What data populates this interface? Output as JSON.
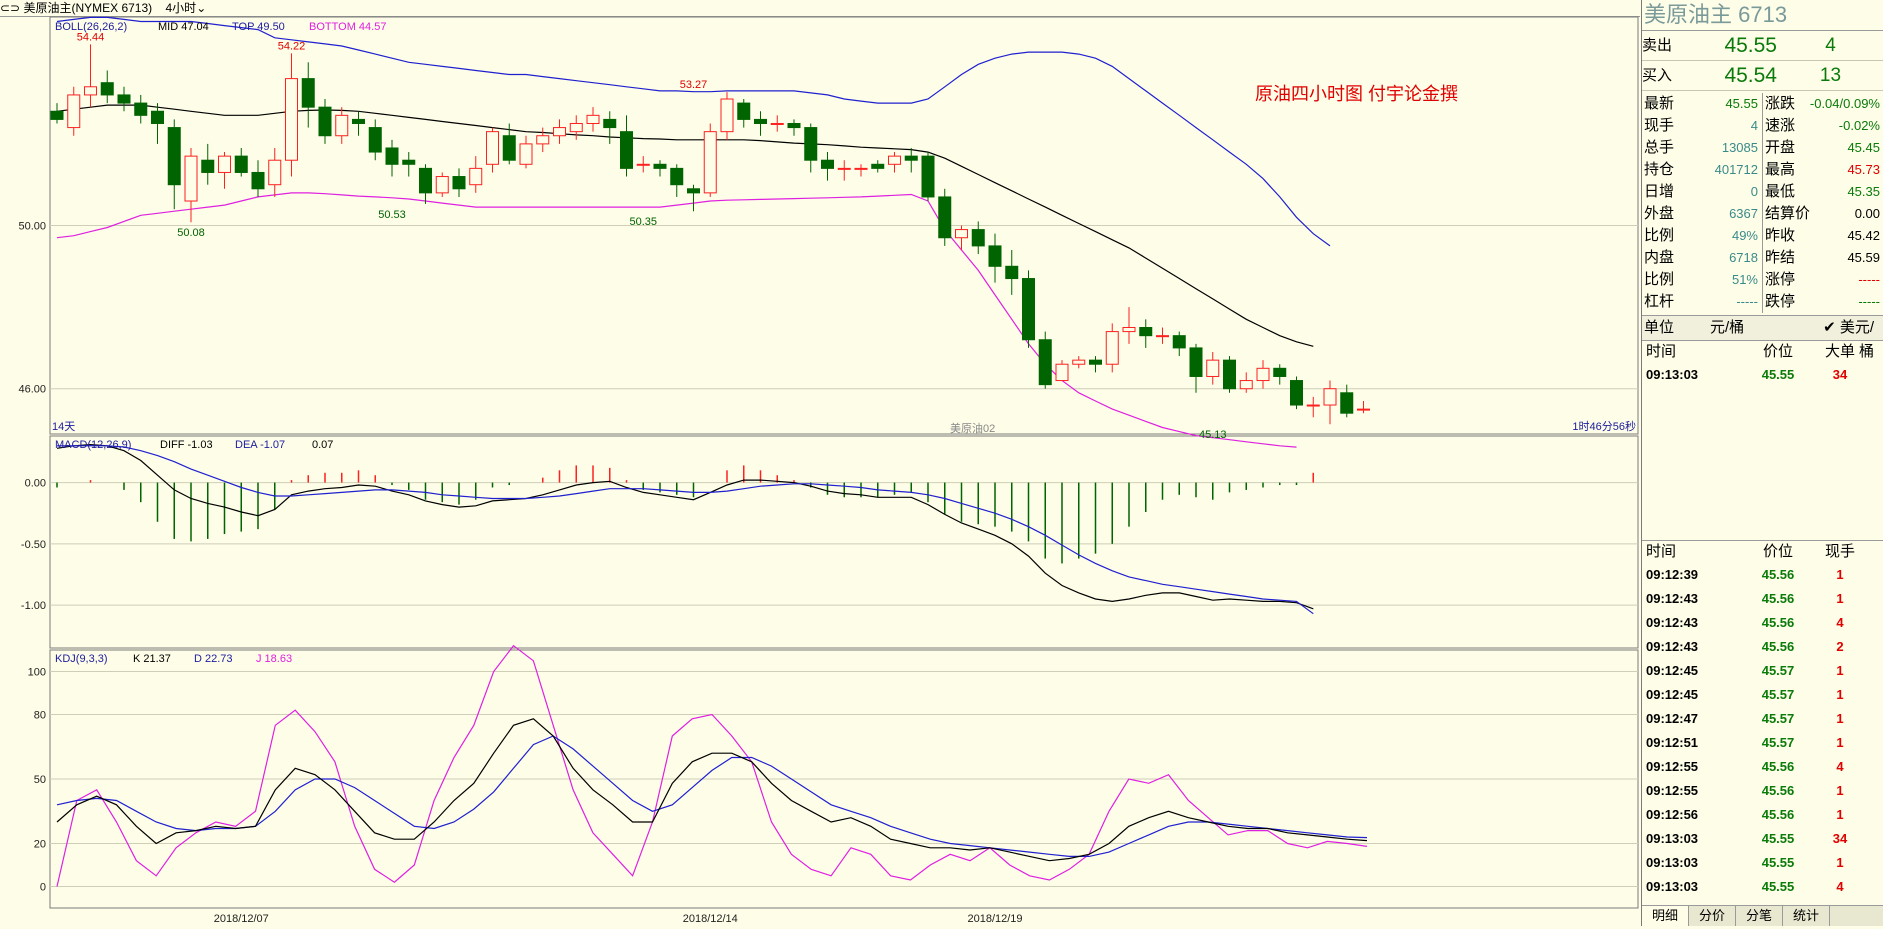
{
  "header": {
    "symbol": "美原油主(NYMEX 6713)",
    "period": "4小时"
  },
  "colors": {
    "up": "#ff2020",
    "down": "#006400",
    "boll_band": "#2020d0",
    "boll_bottom": "#e020e0",
    "mid": "#000000",
    "k": "#000000",
    "d": "#2020d0",
    "j": "#e020e0",
    "bg": "#fdfde8",
    "grid": "#cfcfb8"
  },
  "chart_data": {
    "type": "candlestick",
    "x_tick_labels": [
      "2018/12/07",
      "2018/12/14",
      "2018/12/19"
    ],
    "x_tick_index": [
      11,
      39,
      56
    ],
    "price_axis": {
      "ticks": [
        50.0,
        46.0
      ],
      "tick_labels": [
        "50.00",
        "46.00"
      ],
      "ylim": [
        44.89,
        55.11
      ]
    },
    "boll": {
      "label": "BOLL(26,26,2)",
      "mid_label": "MID 47.04",
      "top_label": "TOP 49.50",
      "bottom_label": "BOTTOM 44.57"
    },
    "annotation": "原油四小时图  付宇论金撰",
    "peak_labels": [
      {
        "text": "54.44",
        "index": 2,
        "value": 54.44,
        "kind": "high"
      },
      {
        "text": "54.22",
        "index": 14,
        "value": 54.22,
        "kind": "high"
      },
      {
        "text": "53.27",
        "index": 38,
        "value": 53.27,
        "kind": "high"
      },
      {
        "text": "50.08",
        "index": 8,
        "value": 50.08,
        "kind": "low"
      },
      {
        "text": "50.53",
        "index": 20,
        "value": 50.53,
        "kind": "low"
      },
      {
        "text": "50.35",
        "index": 35,
        "value": 50.35,
        "kind": "low"
      },
      {
        "text": "45.13",
        "index": 69,
        "value": 45.13,
        "kind": "low"
      }
    ],
    "candles": [
      [
        52.8,
        52.6,
        53.0,
        52.5
      ],
      [
        52.4,
        53.2,
        53.4,
        52.2
      ],
      [
        53.2,
        53.4,
        54.44,
        52.9
      ],
      [
        53.5,
        53.2,
        53.8,
        53.0
      ],
      [
        53.2,
        53.0,
        53.4,
        52.8
      ],
      [
        53.0,
        52.7,
        53.2,
        52.5
      ],
      [
        52.8,
        52.5,
        53.0,
        52.0
      ],
      [
        52.4,
        51.0,
        52.6,
        50.4
      ],
      [
        50.6,
        51.7,
        51.9,
        50.08
      ],
      [
        51.6,
        51.3,
        52.0,
        51.0
      ],
      [
        51.3,
        51.7,
        51.8,
        50.9
      ],
      [
        51.7,
        51.3,
        51.9,
        51.2
      ],
      [
        51.3,
        50.9,
        51.6,
        50.7
      ],
      [
        51.0,
        51.6,
        51.9,
        50.7
      ],
      [
        51.6,
        53.6,
        54.22,
        51.2
      ],
      [
        53.6,
        52.9,
        54.0,
        52.4
      ],
      [
        52.9,
        52.2,
        53.1,
        52.0
      ],
      [
        52.2,
        52.7,
        52.9,
        52.0
      ],
      [
        52.6,
        52.5,
        52.8,
        52.2
      ],
      [
        52.4,
        51.8,
        52.6,
        51.6
      ],
      [
        51.9,
        51.5,
        52.1,
        51.2
      ],
      [
        51.6,
        51.5,
        51.8,
        51.2
      ],
      [
        51.4,
        50.8,
        51.5,
        50.53
      ],
      [
        50.8,
        51.2,
        51.3,
        50.7
      ],
      [
        51.2,
        50.9,
        51.4,
        50.7
      ],
      [
        51.0,
        51.4,
        51.7,
        50.8
      ],
      [
        51.5,
        52.3,
        52.4,
        51.3
      ],
      [
        52.2,
        51.6,
        52.5,
        51.5
      ],
      [
        51.5,
        52.0,
        52.2,
        51.4
      ],
      [
        52.0,
        52.2,
        52.4,
        51.8
      ],
      [
        52.2,
        52.4,
        52.6,
        52.0
      ],
      [
        52.3,
        52.5,
        52.7,
        52.1
      ],
      [
        52.5,
        52.7,
        52.9,
        52.3
      ],
      [
        52.6,
        52.4,
        52.8,
        52.0
      ],
      [
        52.3,
        51.4,
        52.7,
        51.2
      ],
      [
        51.5,
        51.5,
        51.7,
        51.3
      ],
      [
        51.5,
        51.4,
        51.6,
        51.2
      ],
      [
        51.4,
        51.0,
        51.5,
        50.7
      ],
      [
        50.9,
        50.8,
        51.0,
        50.35
      ],
      [
        50.8,
        52.3,
        52.5,
        50.7
      ],
      [
        52.3,
        53.1,
        53.27,
        52.1
      ],
      [
        53.0,
        52.6,
        53.1,
        52.4
      ],
      [
        52.6,
        52.5,
        52.8,
        52.2
      ],
      [
        52.5,
        52.5,
        52.7,
        52.3
      ],
      [
        52.5,
        52.4,
        52.6,
        52.2
      ],
      [
        52.4,
        51.6,
        52.5,
        51.3
      ],
      [
        51.6,
        51.4,
        51.8,
        51.1
      ],
      [
        51.4,
        51.4,
        51.6,
        51.1
      ],
      [
        51.4,
        51.4,
        51.5,
        51.2
      ],
      [
        51.5,
        51.4,
        51.6,
        51.3
      ],
      [
        51.5,
        51.7,
        51.8,
        51.3
      ],
      [
        51.7,
        51.6,
        51.9,
        51.3
      ],
      [
        51.7,
        50.7,
        51.8,
        50.6
      ],
      [
        50.7,
        49.7,
        50.9,
        49.5
      ],
      [
        49.7,
        49.9,
        50.0,
        49.4
      ],
      [
        49.9,
        49.5,
        50.1,
        49.3
      ],
      [
        49.5,
        49.0,
        49.8,
        48.6
      ],
      [
        49.0,
        48.7,
        49.4,
        48.3
      ],
      [
        48.7,
        47.2,
        48.9,
        47.0
      ],
      [
        47.2,
        46.1,
        47.4,
        46.0
      ],
      [
        46.2,
        46.6,
        46.7,
        46.3
      ],
      [
        46.6,
        46.7,
        46.8,
        46.5
      ],
      [
        46.7,
        46.6,
        46.8,
        46.4
      ],
      [
        46.6,
        47.4,
        47.6,
        46.4
      ],
      [
        47.4,
        47.5,
        48.0,
        47.1
      ],
      [
        47.5,
        47.3,
        47.7,
        47.0
      ],
      [
        47.3,
        47.3,
        47.5,
        47.1
      ],
      [
        47.3,
        47.0,
        47.4,
        46.8
      ],
      [
        47.0,
        46.3,
        47.1,
        45.9
      ],
      [
        46.3,
        46.7,
        46.9,
        46.1
      ],
      [
        46.7,
        46.0,
        46.8,
        45.9
      ],
      [
        46.0,
        46.2,
        46.4,
        45.9
      ],
      [
        46.2,
        46.5,
        46.7,
        46.0
      ],
      [
        46.5,
        46.3,
        46.6,
        46.1
      ],
      [
        46.2,
        45.6,
        46.3,
        45.5
      ],
      [
        45.6,
        45.6,
        45.8,
        45.3
      ],
      [
        45.6,
        46.0,
        46.2,
        45.13
      ],
      [
        45.9,
        45.4,
        46.1,
        45.3
      ],
      [
        45.5,
        45.5,
        45.7,
        45.4
      ]
    ],
    "boll_top": [
      55.0,
      55.05,
      55.1,
      55.1,
      55.05,
      55.0,
      55.0,
      55.0,
      55.0,
      54.95,
      54.9,
      54.85,
      54.8,
      54.6,
      54.55,
      54.5,
      54.45,
      54.4,
      54.3,
      54.2,
      54.1,
      54.0,
      53.95,
      53.9,
      53.85,
      53.8,
      53.75,
      53.7,
      53.7,
      53.65,
      53.6,
      53.55,
      53.5,
      53.45,
      53.4,
      53.35,
      53.3,
      53.3,
      53.28,
      53.28,
      53.3,
      53.3,
      53.3,
      53.3,
      53.3,
      53.25,
      53.2,
      53.1,
      53.05,
      53.0,
      53.0,
      53.0,
      53.1,
      53.4,
      53.7,
      53.95,
      54.1,
      54.2,
      54.25,
      54.25,
      54.25,
      54.2,
      54.1,
      53.9,
      53.6,
      53.3,
      53.0,
      52.7,
      52.4,
      52.1,
      51.8,
      51.5,
      51.15,
      50.7,
      50.2,
      49.8,
      49.5
    ],
    "boll_mid": [
      52.8,
      52.85,
      52.9,
      52.95,
      52.95,
      52.95,
      52.9,
      52.85,
      52.8,
      52.75,
      52.7,
      52.7,
      52.7,
      52.75,
      52.8,
      52.82,
      52.83,
      52.82,
      52.8,
      52.75,
      52.7,
      52.65,
      52.6,
      52.55,
      52.5,
      52.45,
      52.4,
      52.35,
      52.3,
      52.28,
      52.25,
      52.22,
      52.2,
      52.17,
      52.15,
      52.13,
      52.12,
      52.1,
      52.1,
      52.1,
      52.1,
      52.1,
      52.08,
      52.05,
      52.02,
      52.0,
      51.98,
      51.95,
      51.92,
      51.9,
      51.88,
      51.86,
      51.8,
      51.65,
      51.45,
      51.25,
      51.05,
      50.85,
      50.65,
      50.45,
      50.25,
      50.05,
      49.85,
      49.65,
      49.45,
      49.2,
      48.95,
      48.7,
      48.45,
      48.2,
      47.95,
      47.7,
      47.5,
      47.3,
      47.15,
      47.04
    ],
    "boll_bottom": [
      49.7,
      49.75,
      49.85,
      49.95,
      50.1,
      50.25,
      50.3,
      50.35,
      50.4,
      50.45,
      50.5,
      50.6,
      50.7,
      50.75,
      50.8,
      50.8,
      50.78,
      50.75,
      50.72,
      50.7,
      50.68,
      50.65,
      50.6,
      50.55,
      50.5,
      50.45,
      50.45,
      50.45,
      50.45,
      50.45,
      50.45,
      50.45,
      50.45,
      50.45,
      50.45,
      50.45,
      50.45,
      50.5,
      50.55,
      50.6,
      50.62,
      50.63,
      50.64,
      50.65,
      50.66,
      50.67,
      50.68,
      50.69,
      50.7,
      50.72,
      50.74,
      50.76,
      50.6,
      49.9,
      49.4,
      48.9,
      48.3,
      47.7,
      47.1,
      46.6,
      46.2,
      45.9,
      45.7,
      45.5,
      45.35,
      45.2,
      45.05,
      44.95,
      44.85,
      44.8,
      44.75,
      44.7,
      44.65,
      44.6,
      44.57
    ],
    "macd": {
      "label": "MACD(12,26,9)",
      "diff_label": "DIFF -1.03",
      "dea_label": "DEA -1.07",
      "macd_label": "0.07",
      "ticks": [
        0.0,
        -0.5,
        -1.0
      ],
      "tick_labels": [
        "0.00",
        "-0.50",
        "-1.00"
      ],
      "ylim": [
        -1.35,
        0.38
      ],
      "diff": [
        0.28,
        0.3,
        0.31,
        0.3,
        0.26,
        0.18,
        0.06,
        -0.06,
        -0.13,
        -0.17,
        -0.2,
        -0.24,
        -0.27,
        -0.22,
        -0.1,
        -0.07,
        -0.05,
        -0.04,
        -0.02,
        -0.03,
        -0.07,
        -0.1,
        -0.15,
        -0.18,
        -0.2,
        -0.19,
        -0.15,
        -0.14,
        -0.13,
        -0.1,
        -0.06,
        -0.02,
        0.0,
        0.01,
        -0.04,
        -0.08,
        -0.1,
        -0.12,
        -0.14,
        -0.08,
        -0.02,
        0.02,
        0.02,
        0.01,
        0.0,
        -0.03,
        -0.07,
        -0.09,
        -0.1,
        -0.12,
        -0.12,
        -0.12,
        -0.18,
        -0.26,
        -0.33,
        -0.38,
        -0.43,
        -0.5,
        -0.6,
        -0.74,
        -0.84,
        -0.9,
        -0.95,
        -0.97,
        -0.95,
        -0.92,
        -0.9,
        -0.9,
        -0.93,
        -0.96,
        -0.95,
        -0.96,
        -0.97,
        -0.97,
        -0.98,
        -1.03
      ],
      "dea": [
        0.3,
        0.3,
        0.3,
        0.3,
        0.29,
        0.26,
        0.22,
        0.17,
        0.11,
        0.06,
        0.01,
        -0.04,
        -0.08,
        -0.11,
        -0.11,
        -0.1,
        -0.09,
        -0.08,
        -0.07,
        -0.06,
        -0.06,
        -0.07,
        -0.08,
        -0.1,
        -0.11,
        -0.12,
        -0.13,
        -0.13,
        -0.13,
        -0.12,
        -0.11,
        -0.09,
        -0.07,
        -0.05,
        -0.05,
        -0.05,
        -0.06,
        -0.07,
        -0.08,
        -0.08,
        -0.07,
        -0.05,
        -0.03,
        -0.02,
        -0.01,
        -0.01,
        -0.02,
        -0.03,
        -0.04,
        -0.06,
        -0.07,
        -0.08,
        -0.1,
        -0.13,
        -0.17,
        -0.21,
        -0.25,
        -0.3,
        -0.36,
        -0.43,
        -0.51,
        -0.59,
        -0.66,
        -0.72,
        -0.77,
        -0.8,
        -0.83,
        -0.85,
        -0.87,
        -0.89,
        -0.91,
        -0.93,
        -0.95,
        -0.96,
        -0.97,
        -1.07
      ]
    },
    "kdj": {
      "label": "KDJ(9,3,3)",
      "k_label": "K 21.37",
      "d_label": "D 22.73",
      "j_label": "J 18.63",
      "ticks": [
        100,
        80,
        50,
        20,
        0
      ],
      "tick_labels": [
        "100",
        "80",
        "50",
        "20",
        "0"
      ],
      "ylim": [
        -10,
        110
      ],
      "k": [
        30,
        38,
        42,
        38,
        28,
        20,
        25,
        26,
        28,
        27,
        28,
        45,
        55,
        52,
        45,
        35,
        25,
        22,
        22,
        30,
        40,
        48,
        62,
        75,
        78,
        70,
        55,
        45,
        38,
        30,
        30,
        48,
        58,
        62,
        62,
        58,
        48,
        40,
        35,
        30,
        32,
        28,
        22,
        20,
        18,
        18,
        17,
        18,
        16,
        14,
        12,
        13,
        15,
        20,
        28,
        32,
        35,
        32,
        30,
        28,
        27,
        27,
        25,
        24,
        23,
        22,
        21.37
      ],
      "d": [
        38,
        40,
        41,
        40,
        35,
        30,
        27,
        26,
        27,
        27,
        28,
        35,
        45,
        50,
        50,
        46,
        40,
        34,
        28,
        27,
        30,
        36,
        44,
        55,
        66,
        70,
        64,
        56,
        48,
        40,
        35,
        38,
        46,
        54,
        60,
        60,
        56,
        50,
        44,
        38,
        35,
        32,
        28,
        25,
        22,
        20,
        19,
        18,
        17,
        16,
        15,
        14,
        14,
        16,
        20,
        24,
        28,
        30,
        30,
        29,
        28,
        27,
        26,
        25,
        24,
        23,
        22.73
      ],
      "j": [
        0,
        40,
        45,
        30,
        12,
        5,
        18,
        25,
        30,
        28,
        35,
        75,
        82,
        72,
        58,
        28,
        8,
        2,
        10,
        40,
        60,
        75,
        100,
        112,
        105,
        75,
        45,
        25,
        15,
        5,
        30,
        70,
        78,
        80,
        70,
        58,
        30,
        15,
        8,
        5,
        18,
        15,
        5,
        3,
        10,
        15,
        12,
        18,
        10,
        5,
        3,
        8,
        15,
        35,
        50,
        48,
        52,
        40,
        32,
        24,
        26,
        26,
        20,
        18,
        21,
        20,
        18.63
      ]
    },
    "labels": {
      "days": "14天",
      "watermark": "美原油02",
      "countdown": "1时46分56秒"
    }
  },
  "quote": {
    "title": "美原油主  6713",
    "sell": {
      "label": "卖出",
      "price": "45.55",
      "volume": "4"
    },
    "buy": {
      "label": "买入",
      "price": "45.54",
      "volume": "13"
    },
    "stats": [
      {
        "k": "最新",
        "v": "45.55",
        "c": "green",
        "k2": "涨跌",
        "v2": "-0.04/0.09%",
        "c2": "green"
      },
      {
        "k": "现手",
        "v": "4",
        "c": "teal",
        "k2": "速涨",
        "v2": "-0.02%",
        "c2": "green"
      },
      {
        "k": "总手",
        "v": "13085",
        "c": "teal",
        "k2": "开盘",
        "v2": "45.45",
        "c2": "green"
      },
      {
        "k": "持仓",
        "v": "401712",
        "c": "teal",
        "k2": "最高",
        "v2": "45.73",
        "c2": "red"
      },
      {
        "k": "日增",
        "v": "0",
        "c": "teal",
        "k2": "最低",
        "v2": "45.35",
        "c2": "green"
      },
      {
        "k": "外盘",
        "v": "6367",
        "c": "teal",
        "k2": "结算价",
        "v2": "0.00",
        "c2": "black"
      },
      {
        "k": "比例",
        "v": "49%",
        "c": "teal",
        "k2": "昨收",
        "v2": "45.42",
        "c2": "black"
      },
      {
        "k": "内盘",
        "v": "6718",
        "c": "teal",
        "k2": "昨结",
        "v2": "45.59",
        "c2": "black"
      },
      {
        "k": "比例",
        "v": "51%",
        "c": "teal",
        "k2": "涨停",
        "v2": "-----",
        "c2": "red"
      },
      {
        "k": "杠杆",
        "v": "-----",
        "c": "teal",
        "k2": "跌停",
        "v2": "-----",
        "c2": "green"
      }
    ],
    "unit": {
      "label": "单位",
      "value": "元/桶",
      "option": "✔ 美元/桶"
    },
    "big_orders": {
      "headers": [
        "时间",
        "价位",
        "大单"
      ],
      "rows": [
        {
          "t": "09:13:03",
          "p": "45.55",
          "v": "34"
        }
      ]
    },
    "ticks": {
      "headers": [
        "时间",
        "价位",
        "现手"
      ],
      "rows": [
        {
          "t": "09:12:39",
          "p": "45.56",
          "v": "1"
        },
        {
          "t": "09:12:43",
          "p": "45.56",
          "v": "1"
        },
        {
          "t": "09:12:43",
          "p": "45.56",
          "v": "4"
        },
        {
          "t": "09:12:43",
          "p": "45.56",
          "v": "2"
        },
        {
          "t": "09:12:45",
          "p": "45.57",
          "v": "1"
        },
        {
          "t": "09:12:45",
          "p": "45.57",
          "v": "1"
        },
        {
          "t": "09:12:47",
          "p": "45.57",
          "v": "1"
        },
        {
          "t": "09:12:51",
          "p": "45.57",
          "v": "1"
        },
        {
          "t": "09:12:55",
          "p": "45.56",
          "v": "4"
        },
        {
          "t": "09:12:55",
          "p": "45.56",
          "v": "1"
        },
        {
          "t": "09:12:56",
          "p": "45.56",
          "v": "1"
        },
        {
          "t": "09:13:03",
          "p": "45.55",
          "v": "34"
        },
        {
          "t": "09:13:03",
          "p": "45.55",
          "v": "1"
        },
        {
          "t": "09:13:03",
          "p": "45.55",
          "v": "4"
        }
      ]
    },
    "tabs": [
      "明细",
      "分价",
      "分笔",
      "统计"
    ]
  }
}
